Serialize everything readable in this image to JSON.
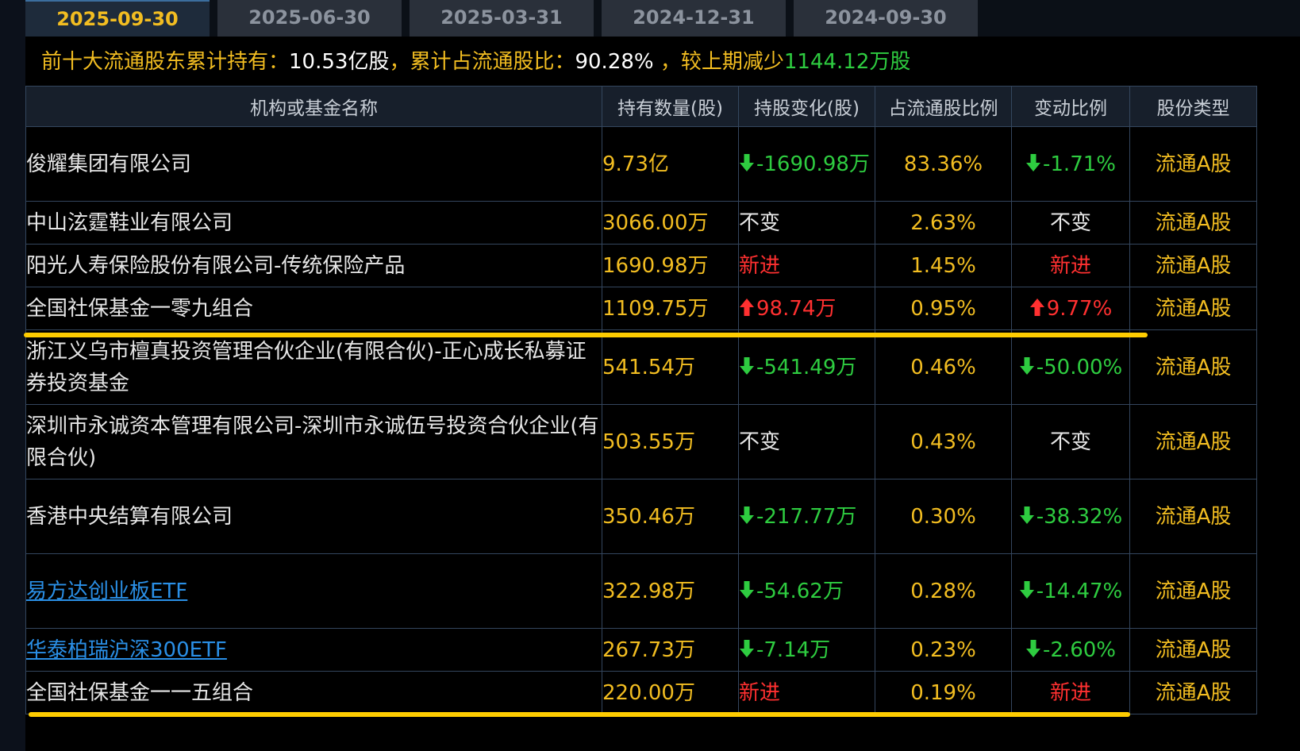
{
  "tabs": [
    {
      "label": "2025-09-30",
      "active": true
    },
    {
      "label": "2025-06-30",
      "active": false
    },
    {
      "label": "2025-03-31",
      "active": false
    },
    {
      "label": "2024-12-31",
      "active": false
    },
    {
      "label": "2024-09-30",
      "active": false
    }
  ],
  "summary": {
    "prefix": "前十大流通股东累计持有：",
    "total": "10.53亿股",
    "ratio_label": "，累计占流通股比：",
    "ratio": "90.28%",
    "change_label": " ，较上期减少",
    "change": "1144.12万股"
  },
  "columns": [
    "机构或基金名称",
    "持有数量(股)",
    "持股变化(股)",
    "占流通股比例",
    "变动比例",
    "股份类型"
  ],
  "rows": [
    {
      "name": "俊耀集团有限公司",
      "link": false,
      "qty": "9.73亿",
      "change": "-1690.98万",
      "change_dir": "down",
      "ratio": "83.36%",
      "pct": "-1.71%",
      "pct_dir": "down",
      "type": "流通A股"
    },
    {
      "name": "中山泫霆鞋业有限公司",
      "link": false,
      "qty": "3066.00万",
      "change": "不变",
      "change_dir": "same",
      "ratio": "2.63%",
      "pct": "不变",
      "pct_dir": "same",
      "type": "流通A股"
    },
    {
      "name": "阳光人寿保险股份有限公司-传统保险产品",
      "link": false,
      "qty": "1690.98万",
      "change": "新进",
      "change_dir": "new",
      "ratio": "1.45%",
      "pct": "新进",
      "pct_dir": "new",
      "type": "流通A股"
    },
    {
      "name": "全国社保基金一零九组合",
      "link": false,
      "qty": "1109.75万",
      "change": "98.74万",
      "change_dir": "up",
      "ratio": "0.95%",
      "pct": "9.77%",
      "pct_dir": "up",
      "type": "流通A股"
    },
    {
      "name": "浙江义乌市檀真投资管理合伙企业(有限合伙)-正心成长私募证券投资基金",
      "link": false,
      "qty": "541.54万",
      "change": "-541.49万",
      "change_dir": "down",
      "ratio": "0.46%",
      "pct": "-50.00%",
      "pct_dir": "down",
      "type": "流通A股"
    },
    {
      "name": "深圳市永诚资本管理有限公司-深圳市永诚伍号投资合伙企业(有限合伙)",
      "link": false,
      "qty": "503.55万",
      "change": "不变",
      "change_dir": "same",
      "ratio": "0.43%",
      "pct": "不变",
      "pct_dir": "same",
      "type": "流通A股"
    },
    {
      "name": "香港中央结算有限公司",
      "link": false,
      "qty": "350.46万",
      "change": "-217.77万",
      "change_dir": "down",
      "ratio": "0.30%",
      "pct": "-38.32%",
      "pct_dir": "down",
      "type": "流通A股"
    },
    {
      "name": "易方达创业板ETF",
      "link": true,
      "qty": "322.98万",
      "change": "-54.62万",
      "change_dir": "down",
      "ratio": "0.28%",
      "pct": "-14.47%",
      "pct_dir": "down",
      "type": "流通A股"
    },
    {
      "name": "华泰柏瑞沪深300ETF",
      "link": true,
      "qty": "267.73万",
      "change": "-7.14万",
      "change_dir": "down",
      "ratio": "0.23%",
      "pct": "-2.60%",
      "pct_dir": "down",
      "type": "流通A股"
    },
    {
      "name": "全国社保基金一一五组合",
      "link": false,
      "qty": "220.00万",
      "change": "新进",
      "change_dir": "new",
      "ratio": "0.19%",
      "pct": "新进",
      "pct_dir": "new",
      "type": "流通A股"
    }
  ],
  "colors": {
    "accent": "#f2bd21",
    "down": "#2ecc40",
    "up": "#ff3030",
    "link": "#2a8fe6",
    "highlight": "#ffcc00"
  }
}
